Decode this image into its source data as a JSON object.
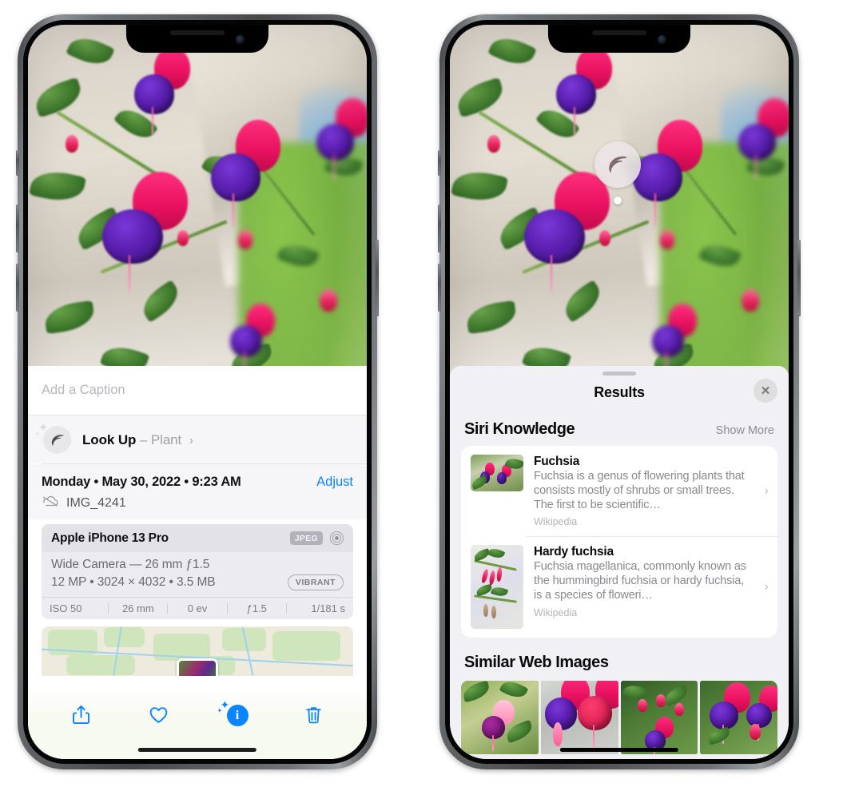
{
  "left_phone": {
    "name": "photos-detail-phone",
    "caption_field": {
      "placeholder": "Add a Caption",
      "value": ""
    },
    "lookup_row": {
      "label": "Look Up",
      "separator": " – ",
      "subject": "Plant",
      "icon": "leaf-icon",
      "chevron": "›"
    },
    "metadata": {
      "date": "Monday • May 30, 2022 • 9:23 AM",
      "adjust_label": "Adjust",
      "filename": "IMG_4241",
      "cloud_icon": "icloud-slash-icon"
    },
    "camera_card": {
      "model": "Apple iPhone 13 Pro",
      "format_badge": "JPEG",
      "hdr_icon": "hdr-circle-icon",
      "lens": "Wide Camera — 26 mm ƒ1.5",
      "specs": "12 MP • 3024 × 4032 • 3.5 MB",
      "style_badge": "VIBRANT",
      "exif": [
        "ISO 50",
        "26 mm",
        "0 ev",
        "ƒ1.5",
        "1/181 s"
      ]
    },
    "toolbar": [
      {
        "name": "share-button",
        "icon": "share-icon",
        "label": "Share"
      },
      {
        "name": "favorite-button",
        "icon": "heart-icon",
        "label": "Favorite"
      },
      {
        "name": "info-button",
        "icon": "info-sparkle-icon",
        "label": "Info",
        "glyph": "i",
        "active": true
      },
      {
        "name": "delete-button",
        "icon": "trash-icon",
        "label": "Delete"
      }
    ]
  },
  "right_phone": {
    "name": "visual-look-up-phone",
    "vlu_indicator": {
      "icon": "leaf-icon",
      "label": "Visual Look Up subject"
    },
    "sheet": {
      "title": "Results",
      "close_label": "✕",
      "sections": [
        {
          "title": "Siri Knowledge",
          "action": "Show More",
          "items": [
            {
              "title": "Fuchsia",
              "description": "Fuchsia is a genus of flowering plants that consists mostly of shrubs or small trees. The first to be scientific…",
              "source": "Wikipedia",
              "chevron": "›"
            },
            {
              "title": "Hardy fuchsia",
              "description": "Fuchsia magellanica, commonly known as the hummingbird fuchsia or hardy fuchsia, is a species of floweri…",
              "source": "Wikipedia",
              "chevron": "›"
            }
          ]
        },
        {
          "title": "Similar Web Images",
          "items_count": 4
        }
      ]
    }
  },
  "colors": {
    "accent_blue": "#0a84ff",
    "sheet_bg": "#f1f1f5",
    "card_bg": "#ffffff",
    "secondary_text": "#88888f",
    "tertiary_text": "#b3b3b9"
  }
}
